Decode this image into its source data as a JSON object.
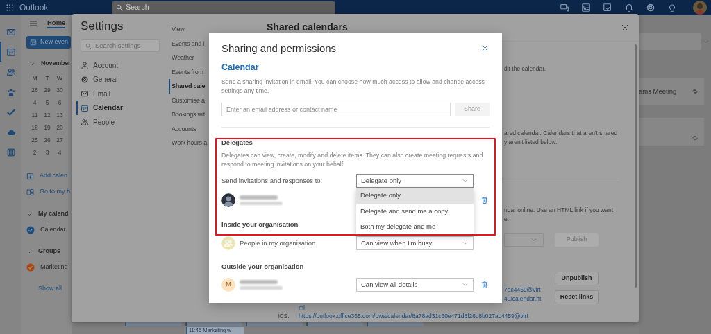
{
  "top_bar": {
    "app_name": "Outlook",
    "search_placeholder": "Search",
    "actions": [
      {
        "kind": "chat"
      },
      {
        "kind": "doc"
      },
      {
        "kind": "note"
      },
      {
        "kind": "bell"
      },
      {
        "kind": "gear"
      },
      {
        "kind": "bulb"
      }
    ]
  },
  "nav_rail": [
    {
      "kind": "mail",
      "selected": false
    },
    {
      "kind": "calendar",
      "selected": true
    },
    {
      "kind": "people",
      "selected": false
    },
    {
      "kind": "groups",
      "selected": false
    },
    {
      "kind": "todo",
      "selected": false
    },
    {
      "kind": "cloud",
      "selected": false
    },
    {
      "kind": "apps",
      "selected": false
    }
  ],
  "calendar_pane": {
    "tab": "Home",
    "new_event": "New even",
    "month": "November",
    "weekdays": [
      "M",
      "T",
      "W"
    ],
    "weeks": [
      [
        "28",
        "29",
        "30"
      ],
      [
        "4",
        "5",
        "6"
      ],
      [
        "11",
        "12",
        "13"
      ],
      [
        "18",
        "19",
        "20"
      ],
      [
        "25",
        "26",
        "27"
      ],
      [
        "2",
        "3",
        "4"
      ]
    ],
    "links": [
      {
        "kind": "add",
        "label": "Add calen"
      },
      {
        "kind": "bookings",
        "label": "Go to my b"
      }
    ],
    "groups": [
      {
        "title": "My calend",
        "expanded": true,
        "calendars": [
          {
            "name": "Calendar",
            "checked": true,
            "color": "#1a4f82"
          }
        ]
      },
      {
        "title": "Groups",
        "expanded": true,
        "calendars": [
          {
            "name": "Marketing",
            "checked": true,
            "color": "#a8470f"
          }
        ]
      }
    ],
    "show_all": "Show all"
  },
  "calendar_events": [
    {
      "label": "11:45 Marketing w"
    }
  ],
  "right_strip": {
    "cards": [
      {
        "title": "ams Meeting",
        "recurring": true
      },
      {
        "recurring": true
      }
    ]
  },
  "settings": {
    "title": "Settings",
    "search_placeholder": "Search settings",
    "categories": [
      {
        "kind": "person",
        "label": "Account",
        "selected": false
      },
      {
        "kind": "gear",
        "label": "General",
        "selected": false
      },
      {
        "kind": "mail",
        "label": "Email",
        "selected": false
      },
      {
        "kind": "calendar",
        "label": "Calendar",
        "selected": true
      },
      {
        "kind": "people",
        "label": "People",
        "selected": false
      }
    ],
    "sections": [
      {
        "label": "View",
        "selected": false
      },
      {
        "label": "Events and i",
        "selected": false
      },
      {
        "label": "Weather",
        "selected": false
      },
      {
        "label": "Events from",
        "selected": false
      },
      {
        "label": "Shared cale",
        "selected": true
      },
      {
        "label": "Customise a",
        "selected": false
      },
      {
        "label": "Bookings wit",
        "selected": false
      },
      {
        "label": "Accounts",
        "selected": false
      },
      {
        "label": "Work hours a",
        "selected": false
      }
    ],
    "panel": {
      "title": "Shared calendars",
      "share_note_tail": "dit the calendar.",
      "shared_list_note": [
        "ared calendar. Calendars that aren't shared",
        "y aren't listed below."
      ],
      "publish_note": [
        "ndar online. Use an HTML link if you want",
        "e."
      ],
      "publish_button": {
        "label": "Publish",
        "disabled": true
      },
      "unpublish_button": "Unpublish",
      "reset_button": "Reset links",
      "html_link_lines": [
        "7ac4459@virt",
        "40/calendar.ht",
        "ml"
      ],
      "ics_label": "ICS:",
      "ics_link": "https://outlook.office365.com/owa/calendar/8a78ad31c60e471d8f26c8b027ac4459@virt"
    }
  },
  "sharing_dialog": {
    "title": "Sharing and permissions",
    "calendar_name": "Calendar",
    "description": "Send a sharing invitation in email. You can choose how much access to allow and change access settings any time.",
    "invite_placeholder": "Enter an email address or contact name",
    "share_button": {
      "label": "Share",
      "disabled": true
    },
    "delegates": {
      "title": "Delegates",
      "description": "Delegates can view, create, modify and delete items. They can also create meeting requests and respond to meeting invitations on your behalf.",
      "send_to_label": "Send invitations and responses to:",
      "send_to": {
        "value": "Delegate only",
        "expanded": true,
        "options": [
          {
            "label": "Delegate only",
            "selected": true
          },
          {
            "label": "Delegate and send me a copy",
            "selected": false
          },
          {
            "label": "Both my delegate and me",
            "selected": false
          }
        ]
      },
      "people": [
        {
          "kind": "photo",
          "redacted": true,
          "deletable": true
        }
      ]
    },
    "groups": [
      {
        "title": "Inside your organisation",
        "entries": [
          {
            "kind": "group",
            "name": "People in my organisation",
            "permission": "Can view when I'm busy",
            "deletable": false
          }
        ]
      },
      {
        "title": "Outside your organisation",
        "entries": [
          {
            "kind": "initial",
            "initial": "M",
            "redacted": true,
            "permission": "Can view all details",
            "deletable": true
          }
        ]
      }
    ]
  }
}
